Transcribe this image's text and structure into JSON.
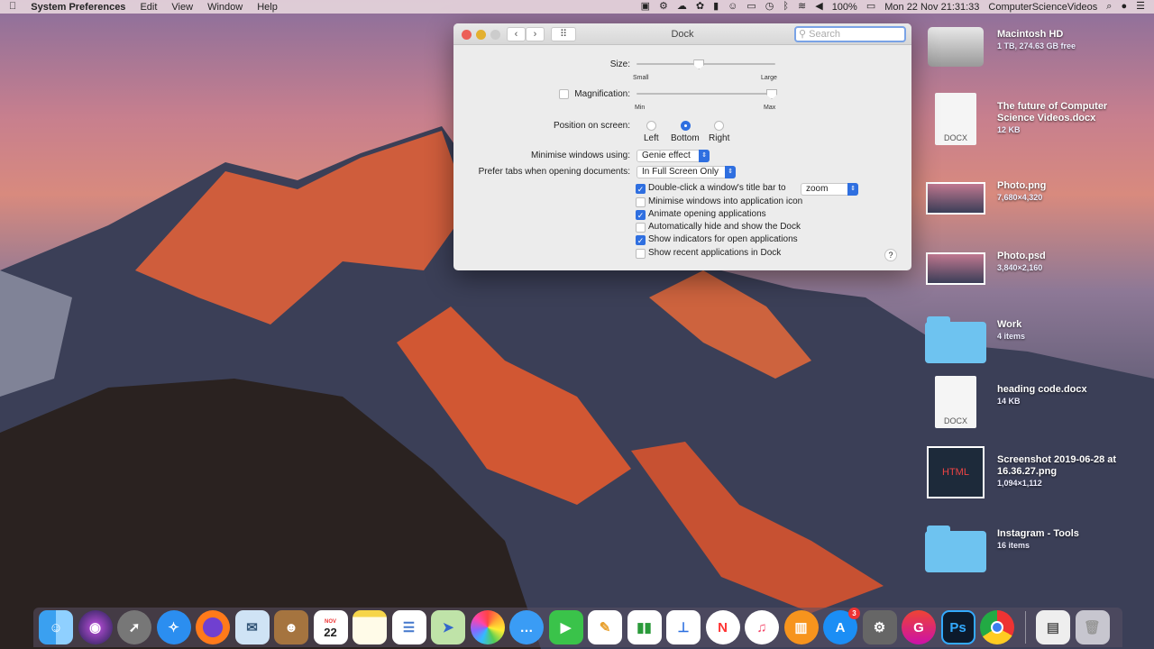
{
  "menubar": {
    "app": "System Preferences",
    "items": [
      "Edit",
      "View",
      "Window",
      "Help"
    ],
    "battery": "100%",
    "datetime": "Mon 22 Nov  21:31:33",
    "user": "ComputerScienceVideos"
  },
  "window": {
    "title": "Dock",
    "search_placeholder": "Search",
    "size": {
      "label": "Size:",
      "min": "Small",
      "max": "Large",
      "value": 0.45
    },
    "magnification": {
      "label": "Magnification:",
      "checked": false,
      "min": "Min",
      "max": "Max",
      "value": 1.0
    },
    "position": {
      "label": "Position on screen:",
      "options": [
        "Left",
        "Bottom",
        "Right"
      ],
      "selected": "Bottom"
    },
    "minimise": {
      "label": "Minimise windows using:",
      "value": "Genie effect"
    },
    "prefer_tabs": {
      "label": "Prefer tabs when opening documents:",
      "value": "In Full Screen Only"
    },
    "double_click": {
      "label": "Double-click a window's title bar to",
      "value": "zoom"
    },
    "checkboxes": [
      {
        "label": "Double-click a window's title bar to",
        "checked": true
      },
      {
        "label": "Minimise windows into application icon",
        "checked": false
      },
      {
        "label": "Animate opening applications",
        "checked": true
      },
      {
        "label": "Automatically hide and show the Dock",
        "checked": false
      },
      {
        "label": "Show indicators for open applications",
        "checked": true
      },
      {
        "label": "Show recent applications in Dock",
        "checked": false
      }
    ],
    "help": "?"
  },
  "desktop": [
    {
      "name": "Macintosh HD",
      "meta": "1 TB, 274.63 GB free",
      "kind": "hdd"
    },
    {
      "name": "The future of Computer Science Videos.docx",
      "meta": "12 KB",
      "kind": "doc",
      "tag": "DOCX"
    },
    {
      "name": "Photo.png",
      "meta": "7,680×4,320",
      "kind": "image"
    },
    {
      "name": "Photo.psd",
      "meta": "3,840×2,160",
      "kind": "image"
    },
    {
      "name": "Work",
      "meta": "4 items",
      "kind": "folder"
    },
    {
      "name": "heading code.docx",
      "meta": "14 KB",
      "kind": "doc",
      "tag": "DOCX"
    },
    {
      "name": "Screenshot 2019-06-28 at 16.36.27.png",
      "meta": "1,094×1,112",
      "kind": "html5",
      "tag": "HTML"
    },
    {
      "name": "Instagram - Tools",
      "meta": "16 items",
      "kind": "folder"
    }
  ],
  "dock": {
    "calendar_month": "NOV",
    "calendar_day": "22",
    "appstore_badge": "3",
    "photoshop": "Ps",
    "google": "G"
  }
}
